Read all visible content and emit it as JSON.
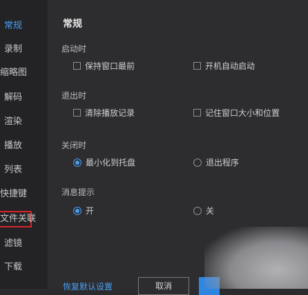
{
  "sidebar": {
    "items": [
      {
        "label": "常规",
        "active": true
      },
      {
        "label": "录制"
      },
      {
        "label": "缩略图"
      },
      {
        "label": "解码"
      },
      {
        "label": "渲染"
      },
      {
        "label": "播放"
      },
      {
        "label": "列表"
      },
      {
        "label": "快捷键"
      },
      {
        "label": "文件关联",
        "highlighted": true
      },
      {
        "label": "滤镜"
      },
      {
        "label": "下载"
      }
    ]
  },
  "main": {
    "title": "常规",
    "sections": {
      "startup": {
        "label": "启动时",
        "options": [
          {
            "label": "保持窗口最前",
            "checked": false
          },
          {
            "label": "开机自动启动",
            "checked": false
          }
        ]
      },
      "exit": {
        "label": "退出时",
        "options": [
          {
            "label": "清除播放记录",
            "checked": false
          },
          {
            "label": "记住窗口大小和位置",
            "checked": false
          }
        ]
      },
      "close": {
        "label": "关闭时",
        "options": [
          {
            "label": "最小化到托盘",
            "selected": true
          },
          {
            "label": "退出程序",
            "selected": false
          }
        ]
      },
      "notify": {
        "label": "消息提示",
        "options": [
          {
            "label": "开",
            "selected": true
          },
          {
            "label": "关",
            "selected": false
          }
        ]
      }
    }
  },
  "footer": {
    "restore_label": "恢复默认设置",
    "cancel_label": "取消"
  },
  "colors": {
    "accent": "#4a9ff2",
    "highlight_border": "#d9252b"
  }
}
